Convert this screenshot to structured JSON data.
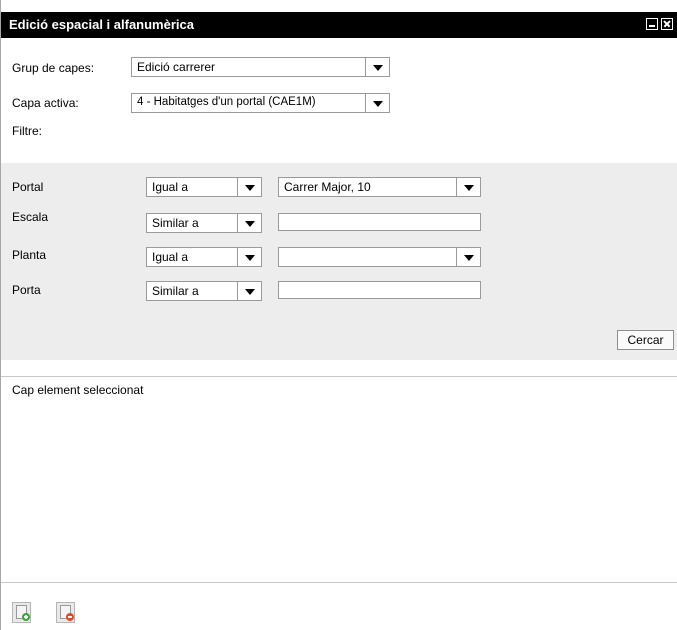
{
  "window": {
    "title": "Edició espacial i alfanumèrica",
    "title_bar_color": "#000000"
  },
  "toolbar_top": {
    "layer_group_label": "Grup de capes:",
    "layer_group_value": "Edició carrerer",
    "active_layer_label": "Capa activa:",
    "active_layer_value": "4 - Habitatges d'un portal (CAE1M)",
    "filter_label": "Filtre:"
  },
  "filter": {
    "panel_color": "#ededed",
    "rows": [
      {
        "label": "Portal",
        "operator": "Igual a",
        "value": "Carrer Major, 10"
      },
      {
        "label": "Escala",
        "operator": "Similar a",
        "value": ""
      },
      {
        "label": "Planta",
        "operator": "Igual a",
        "value": ""
      },
      {
        "label": "Porta",
        "operator": "Similar a",
        "value": ""
      }
    ],
    "search_button": "Cercar"
  },
  "results": {
    "empty_message": "Cap element seleccionat"
  },
  "footer": {
    "icons": [
      "add-element-icon",
      "remove-element-icon"
    ]
  }
}
